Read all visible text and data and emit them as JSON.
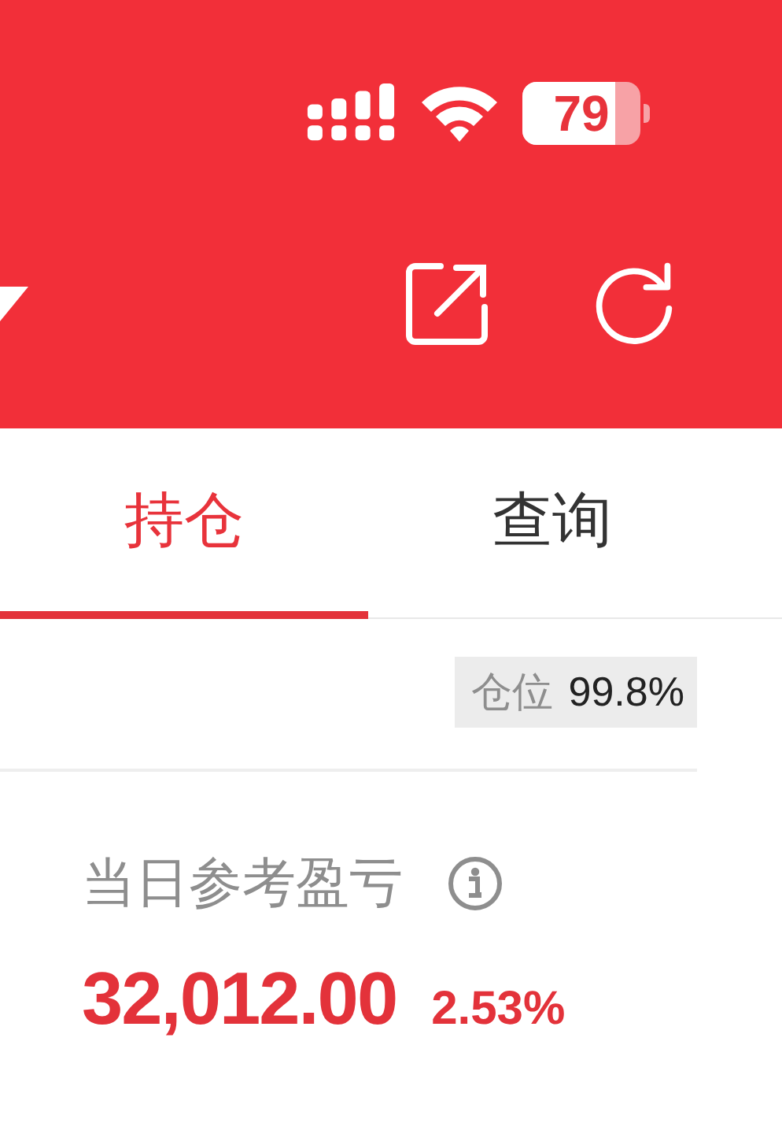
{
  "status_bar": {
    "battery": "79"
  },
  "tabs": [
    {
      "label": "持仓",
      "selected": true
    },
    {
      "label": "查询",
      "selected": false
    }
  ],
  "position": {
    "label": "仓位",
    "value": "99.8%"
  },
  "daily_pnl": {
    "label": "当日参考盈亏",
    "value": "32,012.00",
    "percent": "2.53%"
  }
}
